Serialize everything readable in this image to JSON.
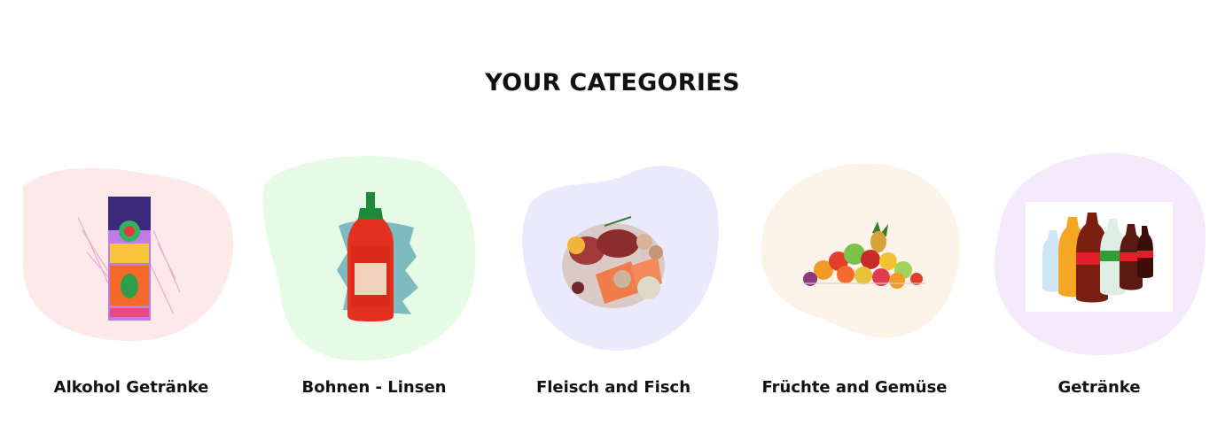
{
  "section": {
    "title": "YOUR CATEGORIES"
  },
  "categories": [
    {
      "label": "Alkohol Getränke",
      "blob_color": "#fde9ea",
      "image": "beverage-box-icon"
    },
    {
      "label": "Bohnen - Linsen",
      "blob_color": "#e6fbe6",
      "image": "sriracha-bottle-icon"
    },
    {
      "label": "Fleisch and Fisch",
      "blob_color": "#eaeafc",
      "image": "meat-fish-icon"
    },
    {
      "label": "Früchte and Gemüse",
      "blob_color": "#fdf3e9",
      "image": "fruit-pile-icon"
    },
    {
      "label": "Getränke",
      "blob_color": "#f4eafc",
      "image": "soda-bottles-icon"
    }
  ]
}
